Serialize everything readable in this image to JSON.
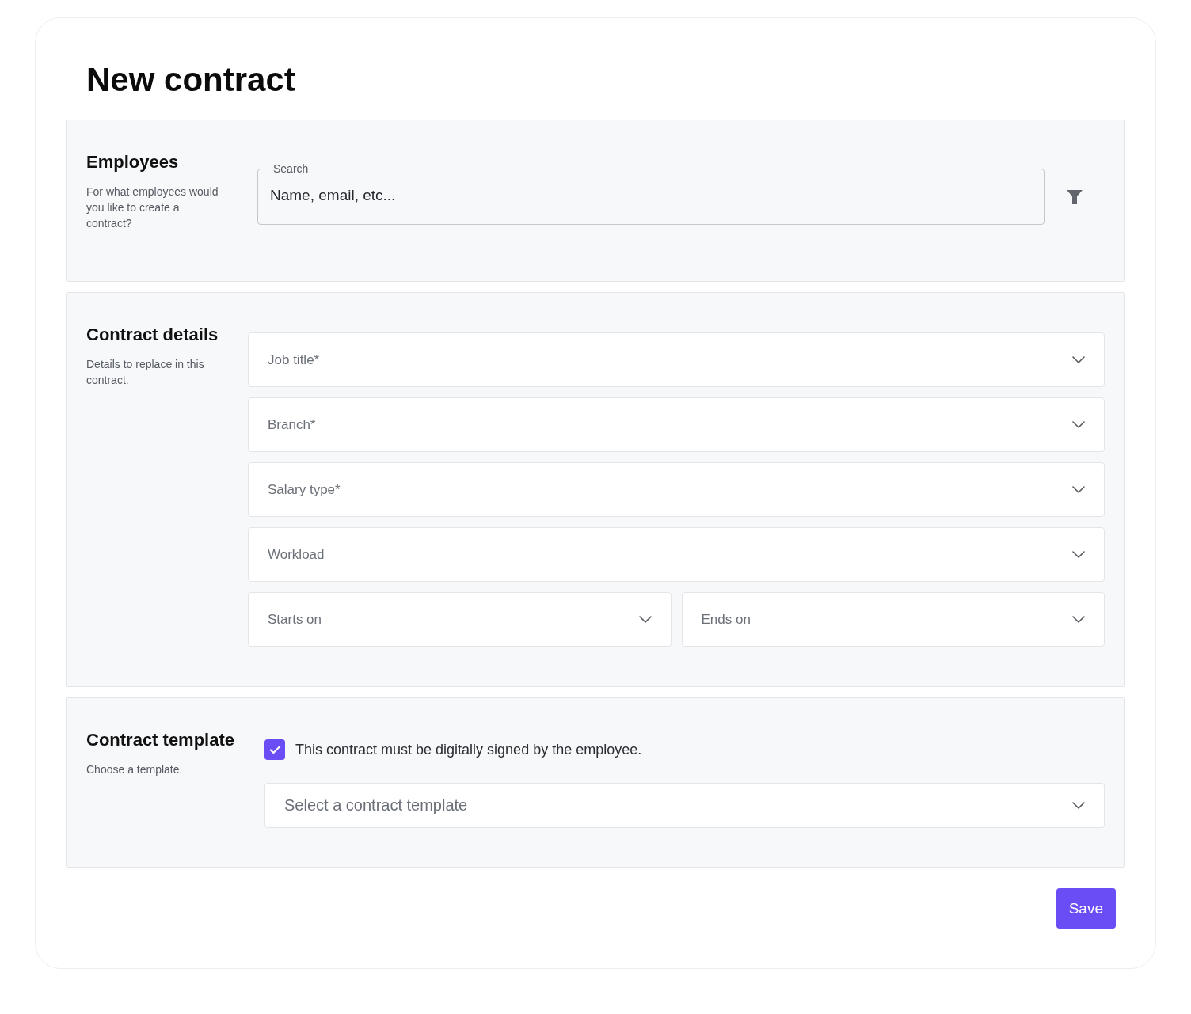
{
  "title": "New contract",
  "employees": {
    "heading": "Employees",
    "description": "For what employees would you like to create a contract?",
    "search": {
      "label": "Search",
      "placeholder": "Name, email, etc..."
    }
  },
  "contract_details": {
    "heading": "Contract details",
    "description": "Details to replace in this contract.",
    "rows": [
      {
        "fields": [
          {
            "placeholder": "Job title*"
          }
        ]
      },
      {
        "fields": [
          {
            "placeholder": "Branch*"
          }
        ]
      },
      {
        "fields": [
          {
            "placeholder": "Salary type*"
          }
        ]
      },
      {
        "fields": [
          {
            "placeholder": "Workload"
          }
        ]
      },
      {
        "fields": [
          {
            "placeholder": "Starts on"
          },
          {
            "placeholder": "Ends on"
          }
        ]
      }
    ]
  },
  "contract_template": {
    "heading": "Contract template",
    "description": "Choose a template.",
    "signature": {
      "label": "This contract must be digitally signed by the employee.",
      "checked": true
    },
    "template_select": {
      "placeholder": "Select a contract template"
    }
  },
  "save_button": "Save"
}
